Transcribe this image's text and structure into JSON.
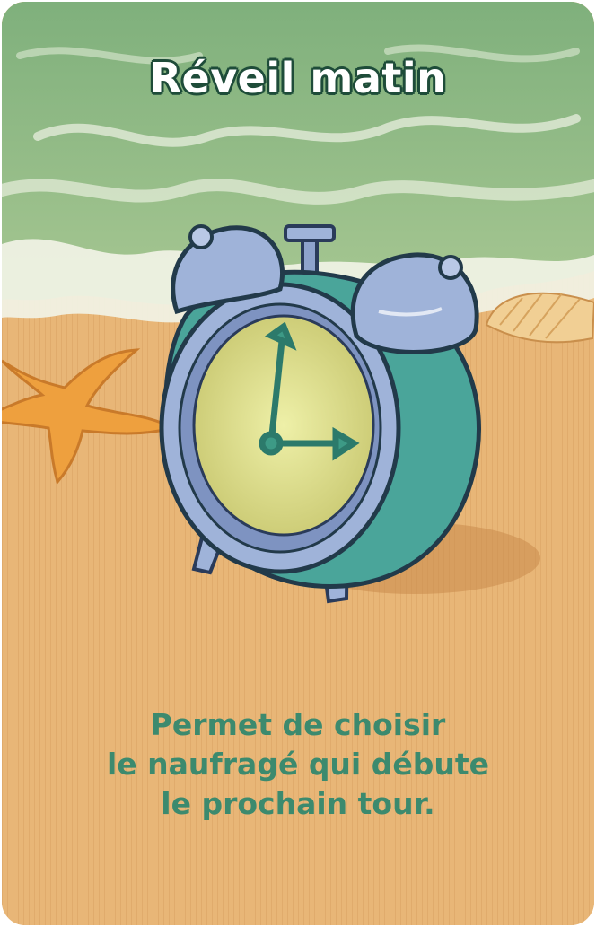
{
  "card": {
    "title": "Réveil matin",
    "description": [
      "Permet de choisir",
      "le naufragé qui débute",
      "le prochain tour."
    ],
    "illustration": "alarm-clock-on-beach",
    "clock_time": "3:00",
    "colors": {
      "sea": "#8fba86",
      "foam": "#f2f4ea",
      "sand": "#e8b677",
      "clock_body": "#4aa59a",
      "bells": "#9fb3d9",
      "dial": "#d9d98a",
      "text": "#3c8a6e",
      "title_outline": "#1f4d3a"
    }
  }
}
